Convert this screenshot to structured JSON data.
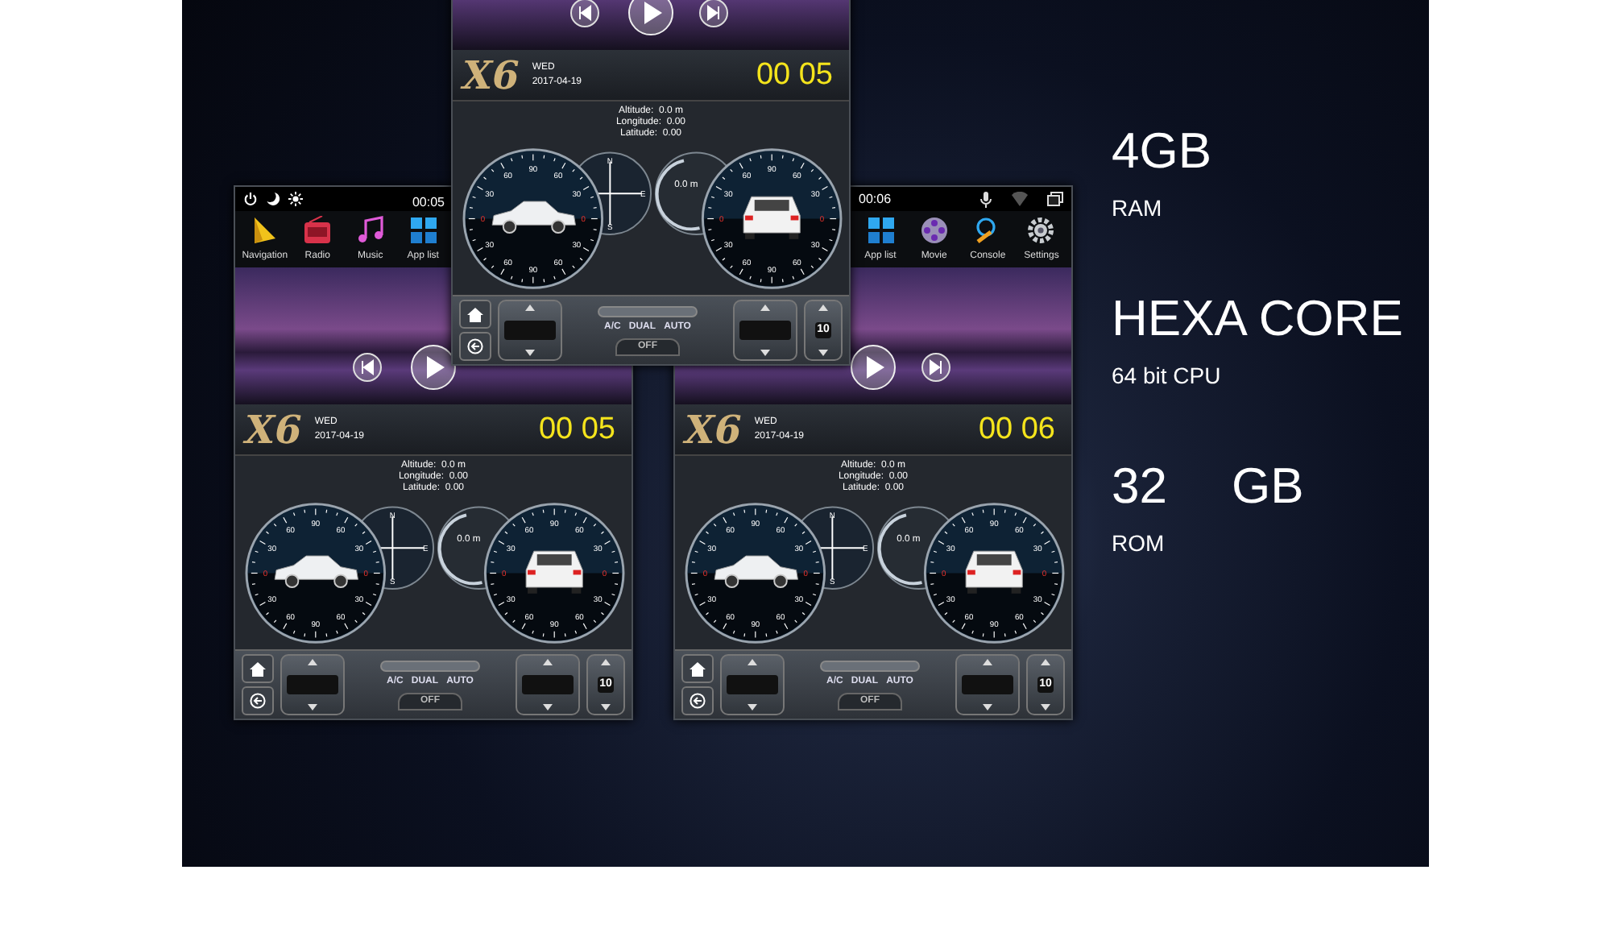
{
  "screens": [
    {
      "kind": "left",
      "status": {
        "time": "00:05"
      },
      "apps": [
        {
          "label": "Navigation"
        },
        {
          "label": "Radio"
        },
        {
          "label": "Music"
        },
        {
          "label": "App list"
        }
      ],
      "logo": "X6",
      "day": "WED",
      "date": "2017-04-19",
      "clock": "00 05",
      "info": [
        "Altitude:  0.0 m",
        "Longitude:  0.00",
        "Latitude:  0.00"
      ],
      "pitch_labels": [
        "0",
        "30",
        "60",
        "90",
        "60",
        "30",
        "0",
        "30",
        "60",
        "90",
        "60",
        "30"
      ],
      "roll_labels": [
        "0",
        "30",
        "60",
        "90",
        "60",
        "30",
        "0",
        "30",
        "60",
        "90",
        "60",
        "30"
      ],
      "compass_labels": [
        "N",
        "E",
        "S"
      ],
      "altimeter": "0.0 m",
      "climate": [
        "A/C",
        "DUAL",
        "AUTO"
      ],
      "off": "OFF",
      "volume": "10"
    },
    {
      "kind": "center",
      "logo": "X6",
      "day": "WED",
      "date": "2017-04-19",
      "clock": "00 05",
      "info": [
        "Altitude:  0.0 m",
        "Longitude:  0.00",
        "Latitude:  0.00"
      ],
      "pitch_labels": [
        "0",
        "30",
        "60",
        "90",
        "60",
        "30",
        "0",
        "30",
        "60",
        "90",
        "60",
        "30"
      ],
      "roll_labels": [
        "0",
        "30",
        "60",
        "90",
        "60",
        "30",
        "0",
        "30",
        "60",
        "90",
        "60",
        "30"
      ],
      "compass_labels": [
        "N",
        "E",
        "S"
      ],
      "altimeter": "0.0 m",
      "climate": [
        "A/C",
        "DUAL",
        "AUTO"
      ],
      "off": "OFF",
      "volume": "10"
    },
    {
      "kind": "right",
      "status": {
        "time": "00:06"
      },
      "apps": [
        {
          "label": "App list"
        },
        {
          "label": "Movie"
        },
        {
          "label": "Console"
        },
        {
          "label": "Settings"
        }
      ],
      "logo": "X6",
      "day": "WED",
      "date": "2017-04-19",
      "clock": "00 06",
      "info": [
        "Altitude:  0.0 m",
        "Longitude:  0.00",
        "Latitude:  0.00"
      ],
      "pitch_labels": [
        "0",
        "30",
        "60",
        "90",
        "60",
        "30",
        "0",
        "30",
        "60",
        "90",
        "60",
        "30"
      ],
      "roll_labels": [
        "0",
        "30",
        "60",
        "90",
        "60",
        "30",
        "0",
        "30",
        "60",
        "90",
        "60",
        "30"
      ],
      "compass_labels": [
        "N",
        "E",
        "S"
      ],
      "altimeter": "0.0 m",
      "climate": [
        "A/C",
        "DUAL",
        "AUTO"
      ],
      "off": "OFF",
      "volume": "10"
    }
  ],
  "specs": [
    {
      "kind": "big",
      "texts": [
        "4GB"
      ]
    },
    {
      "kind": "small",
      "texts": [
        "RAM"
      ]
    },
    {
      "kind": "big",
      "texts": [
        "HEXA CORE"
      ]
    },
    {
      "kind": "small",
      "texts": [
        "64 bit CPU"
      ]
    },
    {
      "kind": "big",
      "texts": [
        "32",
        "GB"
      ]
    },
    {
      "kind": "small",
      "texts": [
        "ROM"
      ]
    }
  ]
}
